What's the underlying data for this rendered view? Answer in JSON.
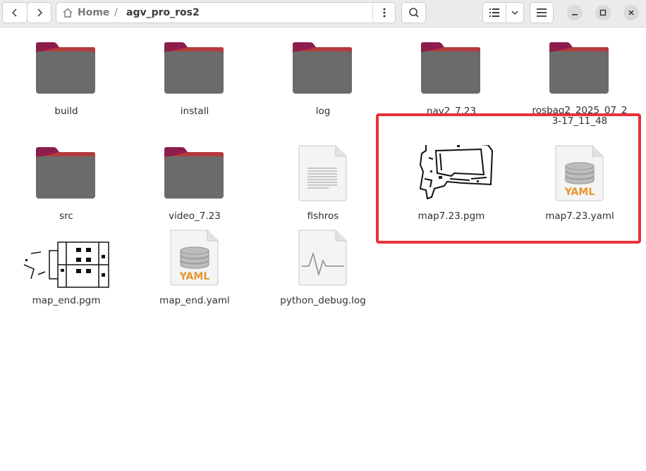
{
  "window": {
    "breadcrumb": {
      "home": "Home",
      "separator": "/",
      "current": "agv_pro_ros2"
    }
  },
  "icons": {
    "back": "chevron-left-icon",
    "forward": "chevron-right-icon",
    "home": "home-icon",
    "path_menu": "vertical-dots-icon",
    "search": "search-icon",
    "view_list": "list-view-icon",
    "view_options": "chevron-down-icon",
    "main_menu": "hamburger-menu-icon",
    "minimize": "minimize-icon",
    "maximize": "maximize-icon",
    "close": "close-icon"
  },
  "colors": {
    "folder_body": "#6b6b6b",
    "folder_tab": "#8c1d4c",
    "yaml_accent": "#e8952c",
    "highlight_box": "#e8323a"
  },
  "files": [
    {
      "name": "build",
      "type": "folder"
    },
    {
      "name": "install",
      "type": "folder"
    },
    {
      "name": "log",
      "type": "folder"
    },
    {
      "name": "nav2_7.23",
      "type": "folder"
    },
    {
      "name": "rosbag2_2025_07_23-17_11_48",
      "type": "folder"
    },
    {
      "name": "src",
      "type": "folder"
    },
    {
      "name": "video_7.23",
      "type": "folder"
    },
    {
      "name": "fishros",
      "type": "text-file"
    },
    {
      "name": "map7.23.pgm",
      "type": "pgm-image"
    },
    {
      "name": "map7.23.yaml",
      "type": "yaml-file",
      "badge": "YAML"
    },
    {
      "name": "map_end.pgm",
      "type": "pgm-image"
    },
    {
      "name": "map_end.yaml",
      "type": "yaml-file",
      "badge": "YAML"
    },
    {
      "name": "python_debug.log",
      "type": "log-file"
    }
  ]
}
